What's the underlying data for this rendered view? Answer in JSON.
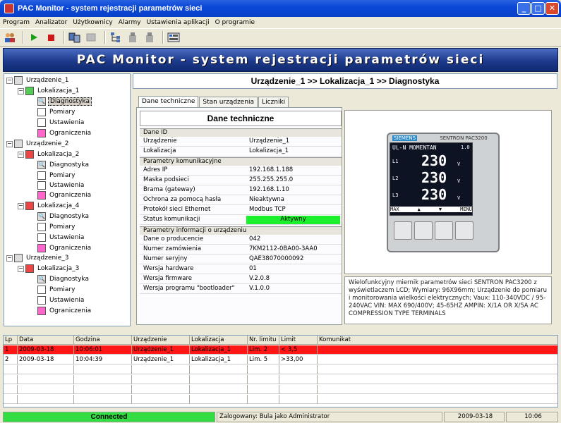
{
  "window": {
    "title": "PAC Monitor - system rejestracji parametrów sieci",
    "min": "_",
    "max": "□",
    "close": "✕"
  },
  "menu": [
    "Program",
    "Analizator",
    "Użytkownicy",
    "Alarmy",
    "Ustawienia aplikacji",
    "O programie"
  ],
  "banner": "PAC Monitor - system rejestracji parametrów sieci",
  "tree": {
    "dev1": "Urządzenie_1",
    "loc1": "Lokalizacja_1",
    "loc1_items": [
      "Diagnostyka",
      "Pomiary",
      "Ustawienia",
      "Ograniczenia"
    ],
    "dev2": "Urządzenie_2",
    "loc2": "Lokalizacja_2",
    "loc2_items": [
      "Diagnostyka",
      "Pomiary",
      "Ustawienia",
      "Ograniczenia"
    ],
    "loc4": "Lokalizacja_4",
    "loc4_items": [
      "Diagnostyka",
      "Pomiary",
      "Ustawienia",
      "Ograniczenia"
    ],
    "dev3": "Urządzenie_3",
    "loc3": "Lokalizacja_3",
    "loc3_items": [
      "Diagnostyka",
      "Pomiary",
      "Ustawienia",
      "Ograniczenia"
    ]
  },
  "breadcrumb": "Urządzenie_1  >>  Lokalizacja_1  >>  Diagnostyka",
  "tabs": [
    "Dane techniczne",
    "Stan urządzenia",
    "Liczniki"
  ],
  "tech": {
    "title": "Dane techniczne",
    "sec_id": "Dane ID",
    "r_dev_k": "Urządzenie",
    "r_dev_v": "Urządzenie_1",
    "r_loc_k": "Lokalizacja",
    "r_loc_v": "Lokalizacja_1",
    "sec_comm": "Parametry komunikacyjne",
    "r_ip_k": "Adres IP",
    "r_ip_v": "192.168.1.188",
    "r_mask_k": "Maska podsieci",
    "r_mask_v": "255.255.255.0",
    "r_gw_k": "Brama (gateway)",
    "r_gw_v": "192.168.1.10",
    "r_pw_k": "Ochrona za pomocą hasła",
    "r_pw_v": "Nieaktywna",
    "r_proto_k": "Protokół sieci Ethernet",
    "r_proto_v": "Modbus TCP",
    "r_stat_k": "Status komunikacji",
    "r_stat_v": "Aktywny",
    "sec_info": "Parametry informacji o urządzeniu",
    "r_prod_k": "Dane o producencie",
    "r_prod_v": "042",
    "r_order_k": "Numer zamówienia",
    "r_order_v": "7KM2112-0BA00-3AA0",
    "r_serial_k": "Numer seryjny",
    "r_serial_v": "QAE38070000092",
    "r_hw_k": "Wersja hardware",
    "r_hw_v": "01",
    "r_fw_k": "Wersja firmware",
    "r_fw_v": "V.2.0.8",
    "r_boot_k": "Wersja programu \"bootloader\"",
    "r_boot_v": "V.1.0.0"
  },
  "device": {
    "brand": "SIEMENS",
    "model": "SENTRON PAC3200",
    "mode": "UL-N MOMENTAN",
    "val_small": "1.0",
    "l1": "L1",
    "l2": "L2",
    "l3": "L3",
    "v1": "230",
    "v2": "230",
    "v3": "230",
    "unit": "V",
    "soft": [
      "MAX",
      "▲",
      "▼",
      "MENU"
    ]
  },
  "description": "Wielofunkcyjny miernik parametrów sieci SENTRON PAC3200 z wyświetlaczem LCD; Wymiary: 96X96mm; Urządzenie do pomiaru i monitorowania wielkości elektrycznych; Vaux: 110-340VDC / 95-240VAC VIN: MAX 690/400V; 45-65HZ AMPIN: X/1A OR X/5A AC COMPRESSION TYPE TERMINALS",
  "grid": {
    "headers": [
      "Lp",
      "Data",
      "Godzina",
      "Urządzenie",
      "Lokalizacja",
      "Nr. limitu",
      "Limit",
      "Komunikat"
    ],
    "rows": [
      {
        "lp": "1",
        "date": "2009-03-18",
        "time": "10:06:01",
        "dev": "Urządzenie_1",
        "loc": "Lokalizacja_1",
        "lim": "Lim.  2",
        "limit": "< 3,5",
        "msg": ""
      },
      {
        "lp": "2",
        "date": "2009-03-18",
        "time": "10:04:39",
        "dev": "Urządzenie_1",
        "loc": "Lokalizacja_1",
        "lim": "Lim.  5",
        "limit": ">33,00",
        "msg": ""
      }
    ]
  },
  "status": {
    "connection": "Connected",
    "user": "Zalogowany: Bula jako Administrator",
    "date": "2009-03-18",
    "time": "10:06"
  },
  "colors": {
    "alarm_row": "#ff1616",
    "connected": "#33dd44",
    "status_active": "#1cf02c",
    "banner": "#1d3a8c"
  }
}
